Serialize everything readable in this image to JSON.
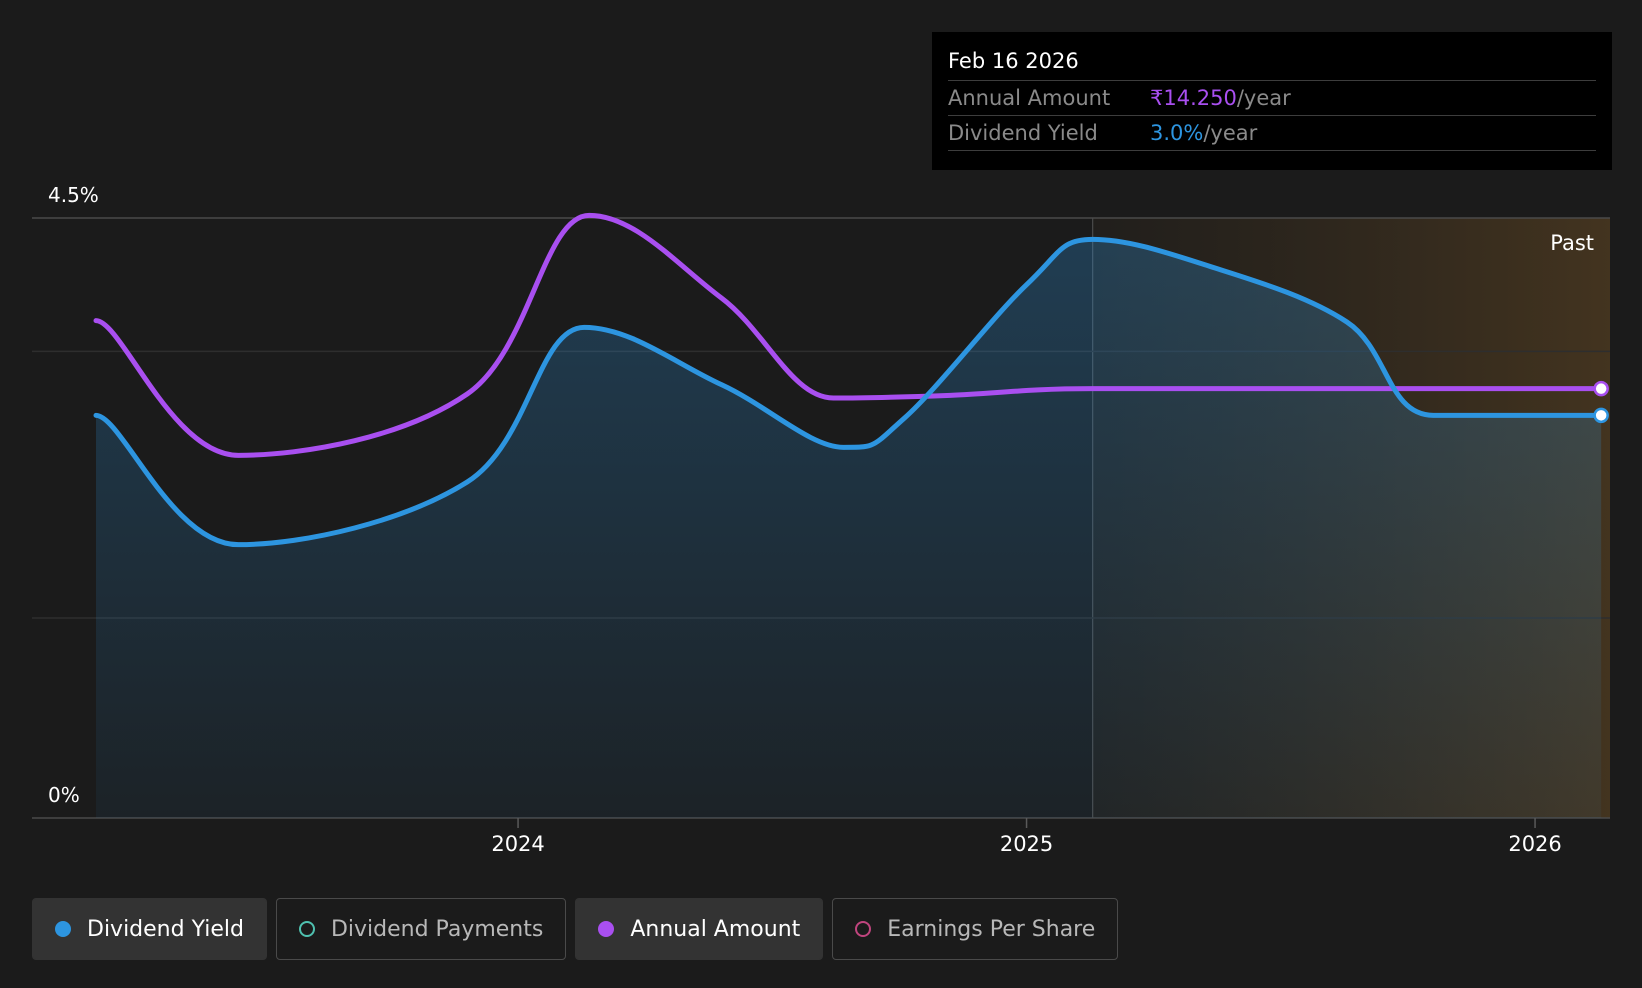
{
  "tooltip": {
    "date": "Feb 16 2026",
    "rows": [
      {
        "label": "Annual Amount",
        "value": "₹14.250",
        "unit": "/year"
      },
      {
        "label": "Dividend Yield",
        "value": "3.0%",
        "unit": "/year"
      }
    ]
  },
  "past_label": "Past",
  "legend": [
    {
      "label": "Dividend Yield",
      "color": "#2d95e0",
      "active": true
    },
    {
      "label": "Dividend Payments",
      "color": "#4fc1b0",
      "active": false
    },
    {
      "label": "Annual Amount",
      "color": "#a94ff0",
      "active": true
    },
    {
      "label": "Earnings Per Share",
      "color": "#c0457e",
      "active": false
    }
  ],
  "colors": {
    "yield": "#2d95e0",
    "amount": "#a94ff0",
    "past_region": "#3a2e1e"
  },
  "chart_data": {
    "type": "line",
    "y_axis": {
      "label_top": "4.5%",
      "label_bottom": "0%",
      "ylim": [
        0,
        4.5
      ]
    },
    "x_axis": {
      "ticks": [
        "2024",
        "2025",
        "2026"
      ],
      "xlim": [
        2023.17,
        2026.13
      ]
    },
    "past_start": 2025.13,
    "series": [
      {
        "name": "Dividend Yield",
        "color": "#2d95e0",
        "area": true,
        "points": [
          [
            2023.17,
            3.02
          ],
          [
            2023.45,
            2.05
          ],
          [
            2023.9,
            2.52
          ],
          [
            2024.13,
            3.68
          ],
          [
            2024.4,
            3.25
          ],
          [
            2024.64,
            2.78
          ],
          [
            2024.76,
            3.0
          ],
          [
            2025.0,
            4.0
          ],
          [
            2025.13,
            4.34
          ],
          [
            2025.35,
            4.15
          ],
          [
            2025.63,
            3.72
          ],
          [
            2025.8,
            3.02
          ],
          [
            2026.13,
            3.02
          ]
        ]
      },
      {
        "name": "Annual Amount",
        "color": "#a94ff0",
        "area": false,
        "points": [
          [
            2023.17,
            3.73
          ],
          [
            2023.45,
            2.72
          ],
          [
            2023.9,
            3.18
          ],
          [
            2024.14,
            4.52
          ],
          [
            2024.4,
            3.9
          ],
          [
            2024.62,
            3.15
          ],
          [
            2024.85,
            3.17
          ],
          [
            2025.13,
            3.22
          ],
          [
            2025.6,
            3.22
          ],
          [
            2026.13,
            3.22
          ]
        ]
      }
    ]
  }
}
